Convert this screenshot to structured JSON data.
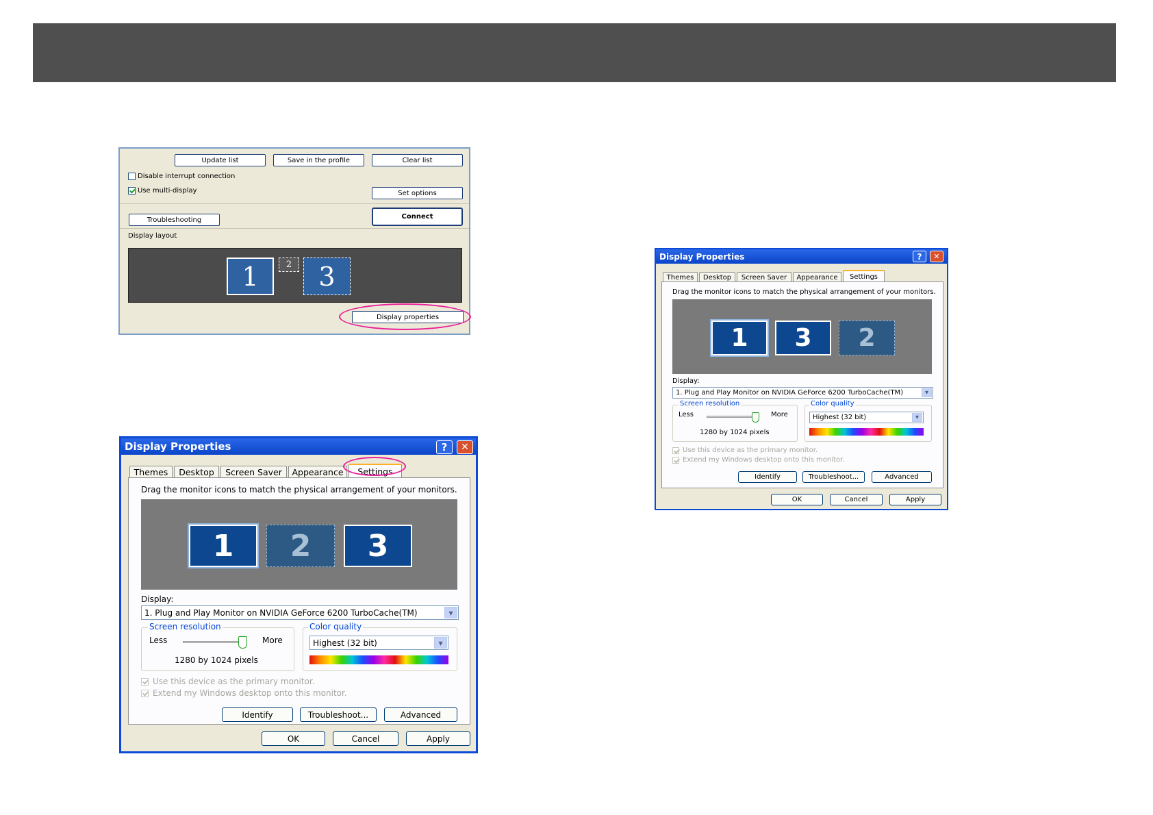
{
  "app": {
    "buttons": {
      "update_list": "Update list",
      "save_profile": "Save in the profile",
      "clear_list": "Clear list",
      "set_options": "Set options",
      "troubleshooting": "Troubleshooting",
      "connect": "Connect",
      "display_properties": "Display properties"
    },
    "checks": {
      "disable_interrupt": "Disable interrupt connection",
      "use_multi_display": "Use multi-display"
    },
    "display_layout_label": "Display layout",
    "monitors": [
      "1",
      "2",
      "3"
    ]
  },
  "dialog_large": {
    "title": "Display Properties",
    "help": "?",
    "close": "✕",
    "tabs": [
      "Themes",
      "Desktop",
      "Screen Saver",
      "Appearance",
      "Settings"
    ],
    "instruction": "Drag the monitor icons to match the physical arrangement of your monitors.",
    "monitors": [
      "1",
      "2",
      "3"
    ],
    "display_label": "Display:",
    "display_value": "1. Plug and Play Monitor on NVIDIA GeForce 6200 TurboCache(TM)",
    "resolution_label": "Screen resolution",
    "less": "Less",
    "more": "More",
    "resolution_value": "1280 by 1024 pixels",
    "color_label": "Color quality",
    "color_value": "Highest (32 bit)",
    "primary_check": "Use this device as the primary monitor.",
    "extend_check": "Extend my Windows desktop onto this monitor.",
    "btn_identify": "Identify",
    "btn_troubleshoot": "Troubleshoot...",
    "btn_advanced": "Advanced",
    "btn_ok": "OK",
    "btn_cancel": "Cancel",
    "btn_apply": "Apply"
  },
  "dialog_small": {
    "title": "Display Properties",
    "help": "?",
    "close": "✕",
    "tabs": [
      "Themes",
      "Desktop",
      "Screen Saver",
      "Appearance",
      "Settings"
    ],
    "instruction": "Drag the monitor icons to match the physical arrangement of your monitors.",
    "monitors": [
      "1",
      "3",
      "2"
    ],
    "display_label": "Display:",
    "display_value": "1. Plug and Play Monitor on NVIDIA GeForce 6200 TurboCache(TM)",
    "resolution_label": "Screen resolution",
    "less": "Less",
    "more": "More",
    "resolution_value": "1280 by 1024 pixels",
    "color_label": "Color quality",
    "color_value": "Highest (32 bit)",
    "primary_check": "Use this device as the primary monitor.",
    "extend_check": "Extend my Windows desktop onto this monitor.",
    "btn_identify": "Identify",
    "btn_troubleshoot": "Troubleshoot...",
    "btn_advanced": "Advanced",
    "btn_ok": "OK",
    "btn_cancel": "Cancel",
    "btn_apply": "Apply"
  },
  "colors": {
    "header": "#4f4f4f",
    "highlight": "#e8209a",
    "xp_title": "#0b45c9"
  }
}
